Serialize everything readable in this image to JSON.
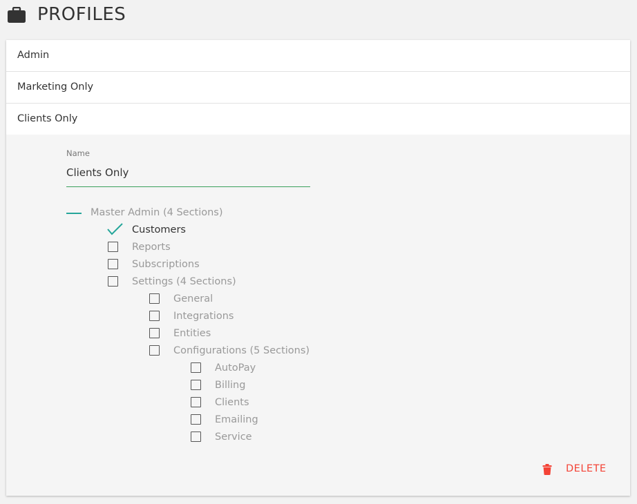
{
  "header": {
    "title": "PROFILES",
    "icon": "briefcase-icon"
  },
  "profiles": [
    {
      "label": "Admin"
    },
    {
      "label": "Marketing Only"
    },
    {
      "label": "Clients Only"
    }
  ],
  "editor": {
    "name_label": "Name",
    "name_value": "Clients Only",
    "accent_color": "#26a69a",
    "underline_color": "#3aa05b"
  },
  "tree": {
    "root": {
      "label": "Master Admin (4 Sections)",
      "state": "indeterminate"
    },
    "items": [
      {
        "label": "Customers",
        "checked": true
      },
      {
        "label": "Reports",
        "checked": false
      },
      {
        "label": "Subscriptions",
        "checked": false
      },
      {
        "label": "Settings (4 Sections)",
        "checked": false
      },
      {
        "label": "General",
        "checked": false
      },
      {
        "label": "Integrations",
        "checked": false
      },
      {
        "label": "Entities",
        "checked": false
      },
      {
        "label": "Configurations (5 Sections)",
        "checked": false
      },
      {
        "label": "AutoPay",
        "checked": false
      },
      {
        "label": "Billing",
        "checked": false
      },
      {
        "label": "Clients",
        "checked": false
      },
      {
        "label": "Emailing",
        "checked": false
      },
      {
        "label": "Service",
        "checked": false
      }
    ]
  },
  "actions": {
    "delete_label": "DELETE",
    "delete_color": "#f44336"
  }
}
